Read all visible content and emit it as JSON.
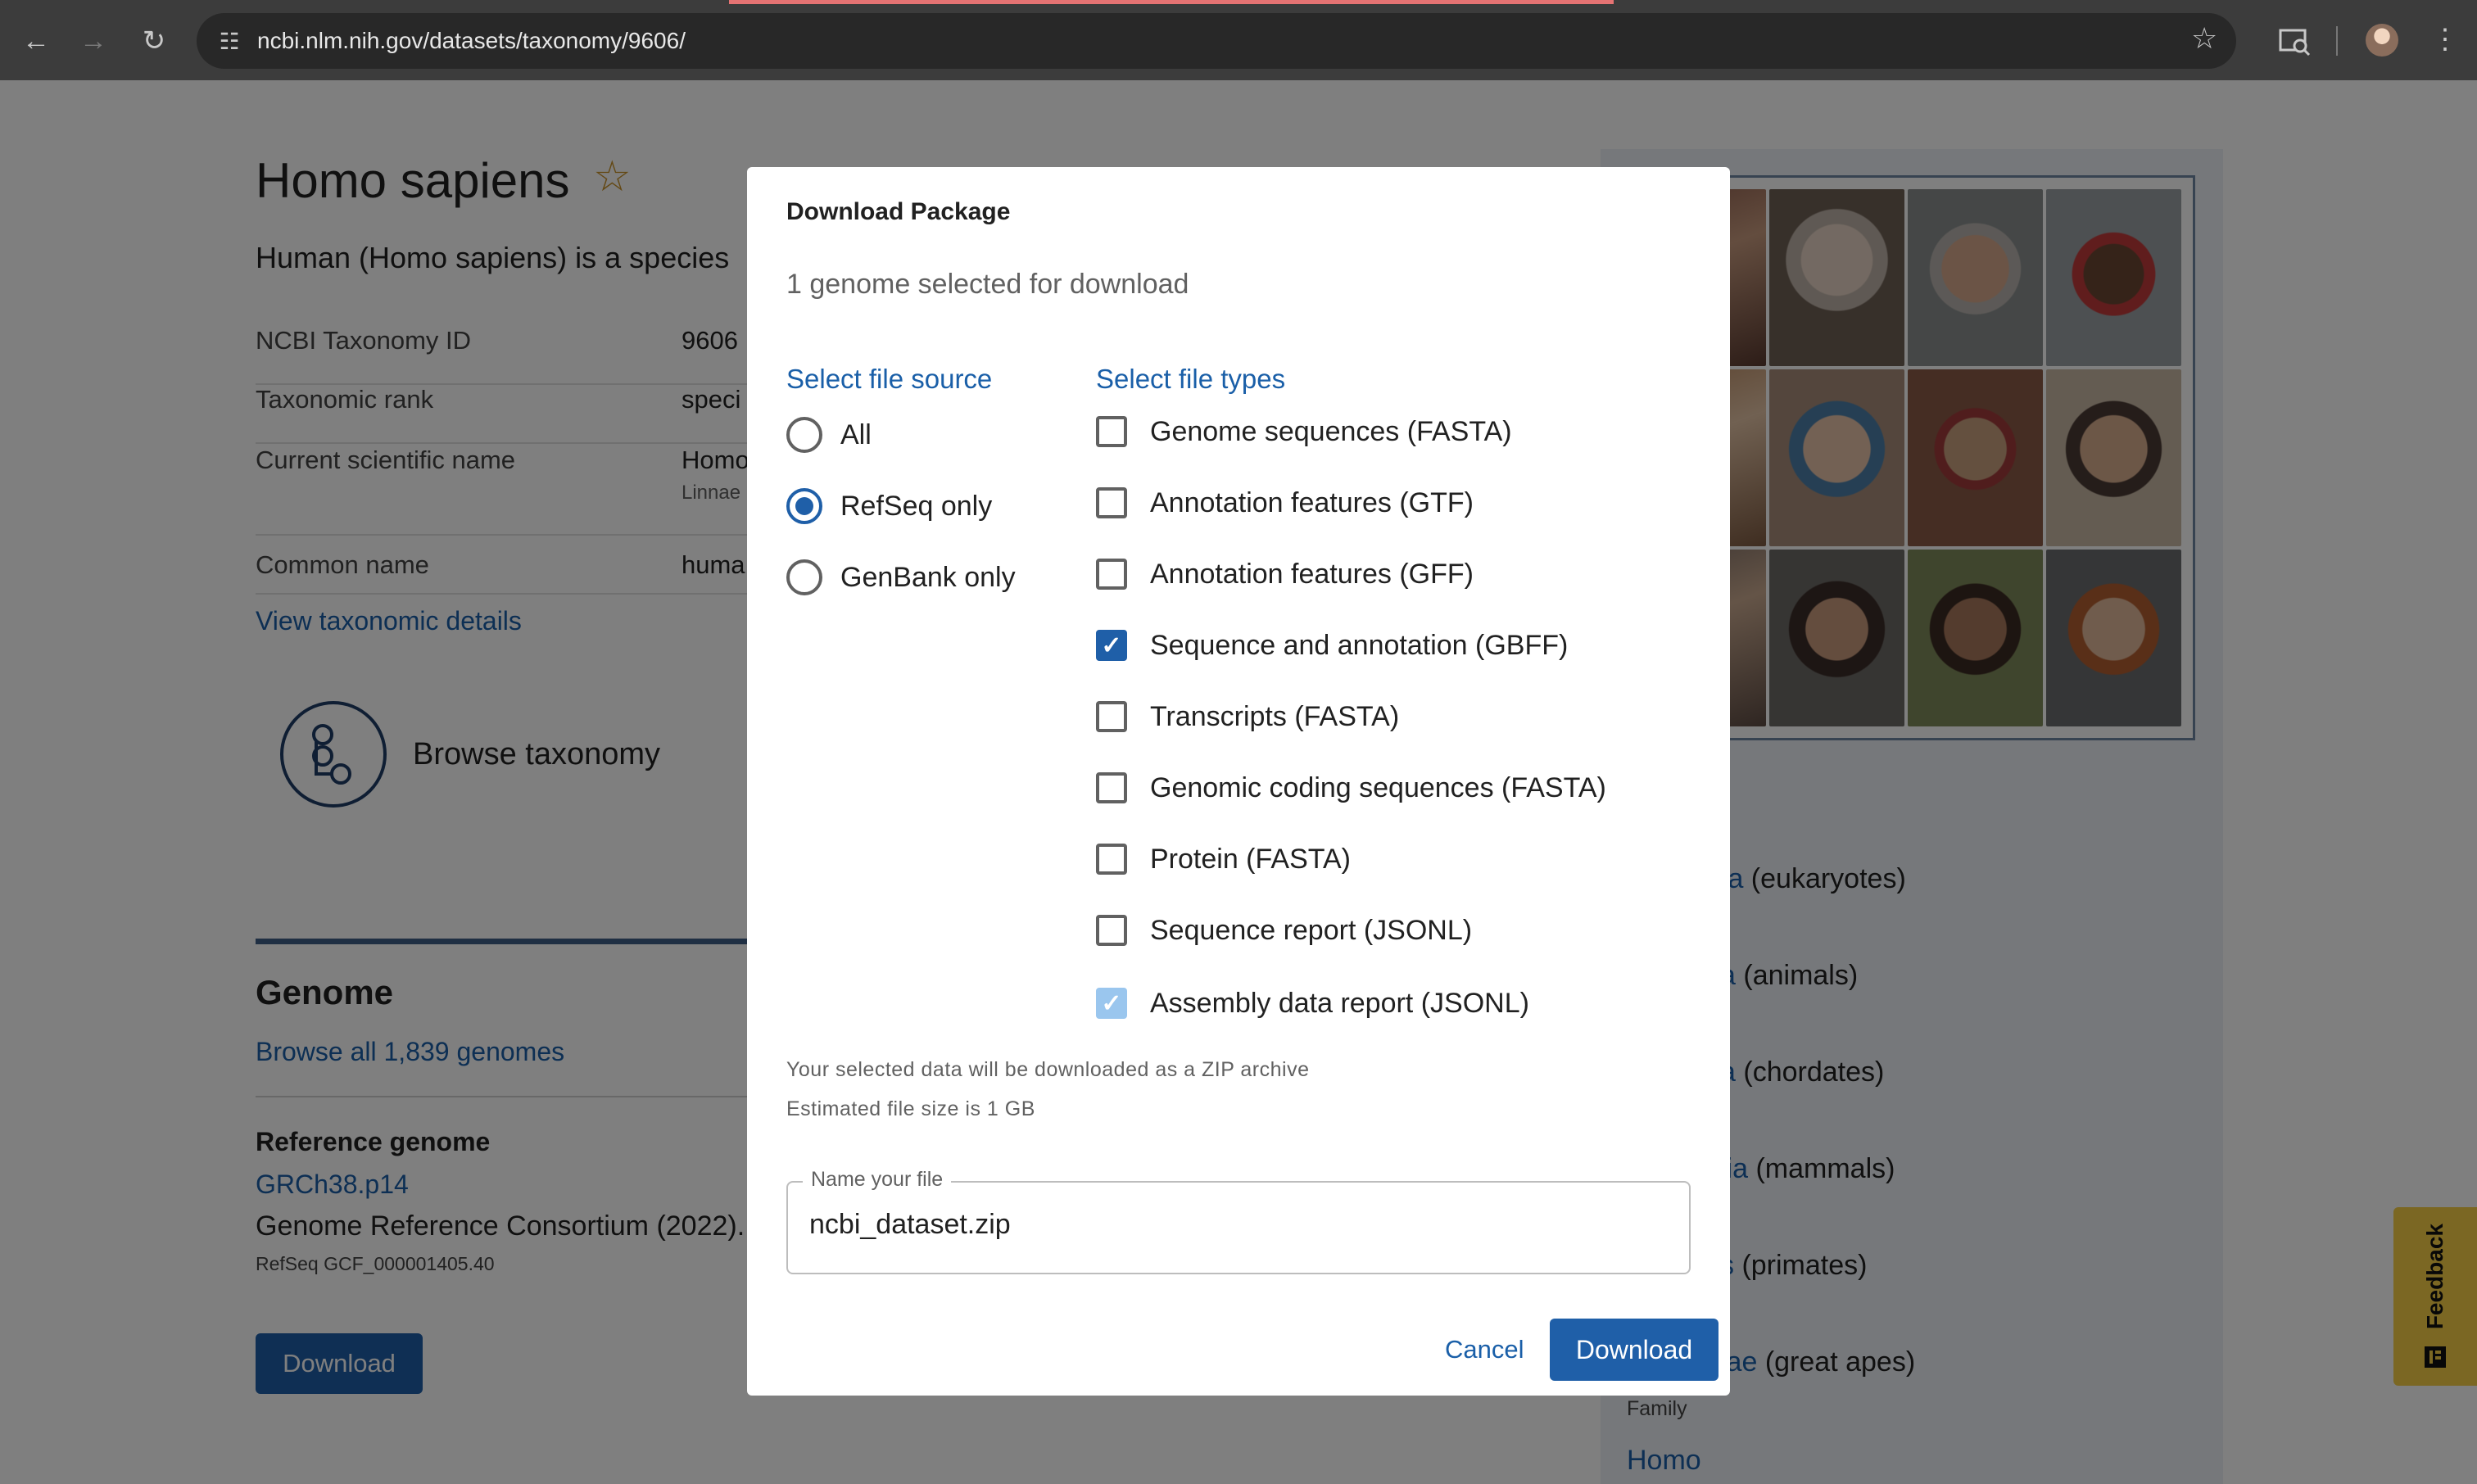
{
  "browser": {
    "url": "ncbi.nlm.nih.gov/datasets/taxonomy/9606/"
  },
  "page": {
    "title": "Homo sapiens",
    "description": "Human (Homo sapiens) is a species",
    "fields": [
      {
        "label": "NCBI Taxonomy ID",
        "value": "9606",
        "sub": ""
      },
      {
        "label": "Taxonomic rank",
        "value": "speci",
        "sub": ""
      },
      {
        "label": "Current scientific name",
        "value": "Homo",
        "sub": "Linnae"
      },
      {
        "label": "Common name",
        "value": "huma",
        "sub": ""
      }
    ],
    "view_taxonomic_details": "View taxonomic details",
    "browse_taxonomy": "Browse taxonomy",
    "genome_heading": "Genome",
    "browse_all_genomes": "Browse all 1,839 genomes",
    "reference_genome_heading": "Reference genome",
    "reference_genome_name": "GRCh38.p14",
    "reference_genome_source": "Genome Reference Consortium (2022).",
    "reference_genome_accession": "RefSeq  GCF_000001405.40",
    "download_button": "Download"
  },
  "lineage": {
    "heading_fragment": "e",
    "items": [
      {
        "link": "ta",
        "text": " (eukaryotes)"
      },
      {
        "link": "a",
        "text": " (animals)"
      },
      {
        "link": "a",
        "text": " (chordates)"
      },
      {
        "link": "lia",
        "text": " (mammals)"
      },
      {
        "link": "s",
        "text": " (primates)"
      },
      {
        "link": "lae",
        "text": " (great apes)"
      }
    ],
    "family_label": "Family",
    "family_value": "Homo"
  },
  "feedback": {
    "label": "Feedback"
  },
  "modal": {
    "title": "Download Package",
    "subtitle": "1 genome selected for download",
    "file_source": {
      "heading": "Select file source",
      "options": [
        "All",
        "RefSeq only",
        "GenBank only"
      ],
      "selected": "RefSeq only"
    },
    "file_types": {
      "heading": "Select file types",
      "options": [
        {
          "label": "Genome sequences (FASTA)",
          "checked": false,
          "disabled": false
        },
        {
          "label": "Annotation features (GTF)",
          "checked": false,
          "disabled": false
        },
        {
          "label": "Annotation features (GFF)",
          "checked": false,
          "disabled": false
        },
        {
          "label": "Sequence and annotation (GBFF)",
          "checked": true,
          "disabled": false
        },
        {
          "label": "Transcripts (FASTA)",
          "checked": false,
          "disabled": false
        },
        {
          "label": "Genomic coding sequences (FASTA)",
          "checked": false,
          "disabled": false
        },
        {
          "label": "Protein (FASTA)",
          "checked": false,
          "disabled": false
        },
        {
          "label": "Sequence report (JSONL)",
          "checked": false,
          "disabled": false
        },
        {
          "label": "Assembly data report (JSONL)",
          "checked": true,
          "disabled": true
        }
      ]
    },
    "zip_note": "Your selected data will be downloaded as a ZIP archive",
    "size_note": "Estimated file size is 1 GB",
    "filename_label": "Name your file",
    "filename_value": "ncbi_dataset.zip",
    "cancel": "Cancel",
    "download": "Download"
  },
  "colors": {
    "accent": "#1f5fa8",
    "link": "#1a5fa8",
    "feedback": "#f7ce46"
  }
}
